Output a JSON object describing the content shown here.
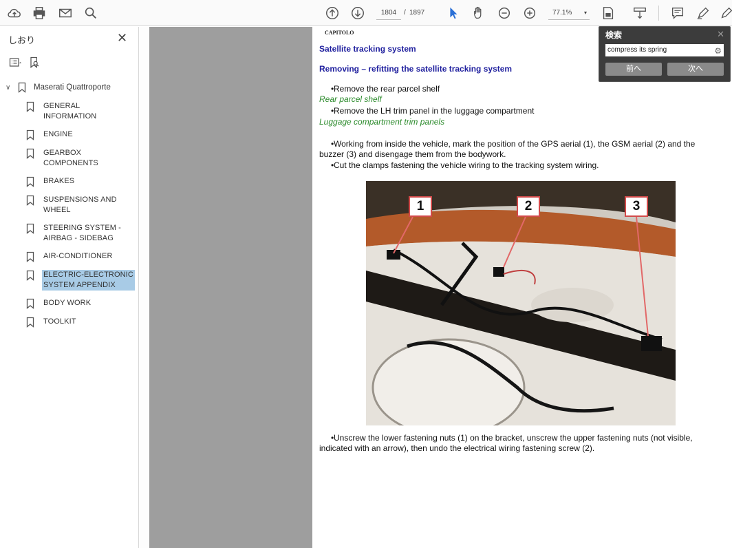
{
  "toolbar": {
    "current_page": "1804",
    "page_sep": "/",
    "total_pages": "1897",
    "zoom": "77.1%"
  },
  "sidebar": {
    "title": "しおり",
    "root": "Maserati Quattroporte",
    "items": [
      {
        "label": "GENERAL INFORMATION"
      },
      {
        "label": "ENGINE"
      },
      {
        "label": "GEARBOX COMPONENTS"
      },
      {
        "label": "BRAKES"
      },
      {
        "label": "SUSPENSIONS AND WHEEL"
      },
      {
        "label": "STEERING SYSTEM - AIRBAG - SIDEBAG"
      },
      {
        "label": "AIR-CONDITIONER"
      },
      {
        "label": "ELECTRIC-ELECTRONIC SYSTEM APPENDIX"
      },
      {
        "label": "BODY WORK"
      },
      {
        "label": "TOOLKIT"
      }
    ]
  },
  "document": {
    "chapter": "CAPITOLO",
    "title": "Satellite tracking system",
    "subtitle": "Removing – refitting the satellite tracking system",
    "step1": "Remove the rear parcel shelf",
    "link1": "Rear parcel shelf",
    "step2": "Remove the LH trim panel in the luggage compartment",
    "link2": "Luggage compartment trim panels",
    "step3_line1": "Working from inside the vehicle, mark the position of the GPS aerial (1), the GSM aerial (2) and the",
    "step3_line2": "buzzer (3) and disengage them from the bodywork.",
    "step4": "Cut the clamps fastening the vehicle wiring to the tracking system wiring.",
    "callouts": [
      "1",
      "2",
      "3"
    ],
    "step5_line1": "Unscrew the lower fastening nuts (1) on the bracket, unscrew the upper fastening nuts (not visible,",
    "step5_line2": "indicated with an arrow), then undo the electrical wiring fastening screw (2)."
  },
  "search": {
    "title": "検索",
    "query": "compress its spring",
    "prev_label": "前へ",
    "next_label": "次へ"
  }
}
